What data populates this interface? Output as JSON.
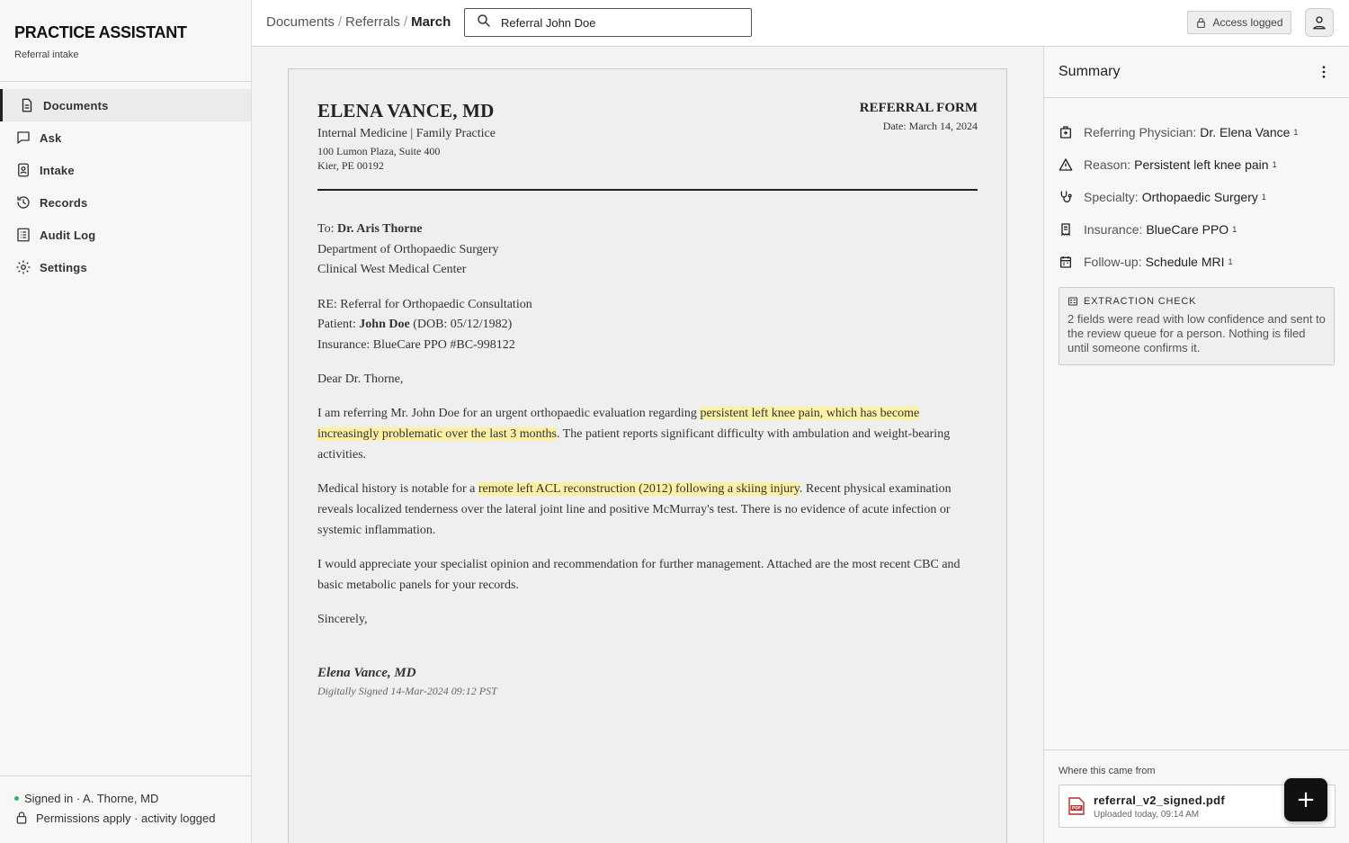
{
  "app": {
    "title": "PRACTICE ASSISTANT",
    "subtitle": "Referral intake"
  },
  "nav": [
    {
      "label": "Documents",
      "icon": "document-icon",
      "active": true
    },
    {
      "label": "Ask",
      "icon": "chat-icon"
    },
    {
      "label": "Intake",
      "icon": "clipboard-user-icon"
    },
    {
      "label": "Records",
      "icon": "history-icon"
    },
    {
      "label": "Audit Log",
      "icon": "list-icon"
    },
    {
      "label": "Settings",
      "icon": "gear-icon"
    }
  ],
  "sidebar_footer": {
    "signed_in": "Signed in · A. Thorne, MD",
    "permissions": "Permissions apply · activity logged",
    "status_color": "#2db36a"
  },
  "breadcrumb": {
    "items": [
      "Documents",
      "Referrals"
    ],
    "current": "March",
    "separator": "/"
  },
  "search": {
    "value": "Referral John Doe"
  },
  "topbar": {
    "access_label": "Access logged"
  },
  "document": {
    "doctor_name": "ELENA VANCE, MD",
    "specialty": "Internal Medicine | Family Practice",
    "address_line1": "100 Lumon Plaza, Suite 400",
    "address_line2": "Kier, PE 00192",
    "form_title": "REFERRAL FORM",
    "form_date": "Date: March 14, 2024",
    "to_prefix": "To: ",
    "to_name": "Dr. Aris Thorne",
    "to_dept": "Department of Orthopaedic Surgery",
    "to_org": "Clinical West Medical Center",
    "re_line": "RE: Referral for Orthopaedic Consultation",
    "patient_prefix": "Patient: ",
    "patient_name": "John Doe",
    "patient_dob": " (DOB: 05/12/1982)",
    "insurance_line": "Insurance: BlueCare PPO #BC-998122",
    "greeting": "Dear Dr. Thorne,",
    "p1_a": "I am referring Mr. John Doe for an urgent orthopaedic evaluation regarding ",
    "p1_hl": "persistent left knee pain, which has become increasingly problematic over the last 3 months",
    "p1_b": ". The patient reports significant difficulty with ambulation and weight-bearing activities.",
    "p2_a": "Medical history is notable for a ",
    "p2_hl": "remote left ACL reconstruction (2012) following a skiing injury",
    "p2_b": ". Recent physical examination reveals localized tenderness over the lateral joint line and positive McMurray's test. There is no evidence of acute infection or systemic inflammation.",
    "p3": "I would appreciate your specialist opinion and recommendation for further management. Attached are the most recent CBC and basic metabolic panels for your records.",
    "closing": "Sincerely,",
    "signature_name": "Elena Vance, MD",
    "signature_stamp": "Digitally Signed 14-Mar-2024 09:12 PST",
    "highlight_color": "#fbf0a4"
  },
  "summary": {
    "title": "Summary",
    "facts": [
      {
        "label": "Referring Physician:",
        "value": "Dr. Elena Vance",
        "ref": "1",
        "icon": "hospital-icon"
      },
      {
        "label": "Reason:",
        "value": "Persistent left knee pain",
        "ref": "1",
        "icon": "warning-icon"
      },
      {
        "label": "Specialty:",
        "value": "Orthopaedic Surgery",
        "ref": "1",
        "icon": "stethoscope-icon"
      },
      {
        "label": "Insurance:",
        "value": "BlueCare PPO",
        "ref": "1",
        "icon": "receipt-icon"
      },
      {
        "label": "Follow-up:",
        "value": "Schedule MRI",
        "ref": "1",
        "icon": "calendar-icon"
      }
    ],
    "check_title": "EXTRACTION CHECK",
    "check_body": "2 fields were read with low confidence and sent to the review queue for a person. Nothing is filed until someone confirms it.",
    "source_label": "Where this came from",
    "source_file": "referral_v2_signed.pdf",
    "source_meta": "Uploaded today, 09:14 AM"
  },
  "fab": {
    "label": "+"
  }
}
